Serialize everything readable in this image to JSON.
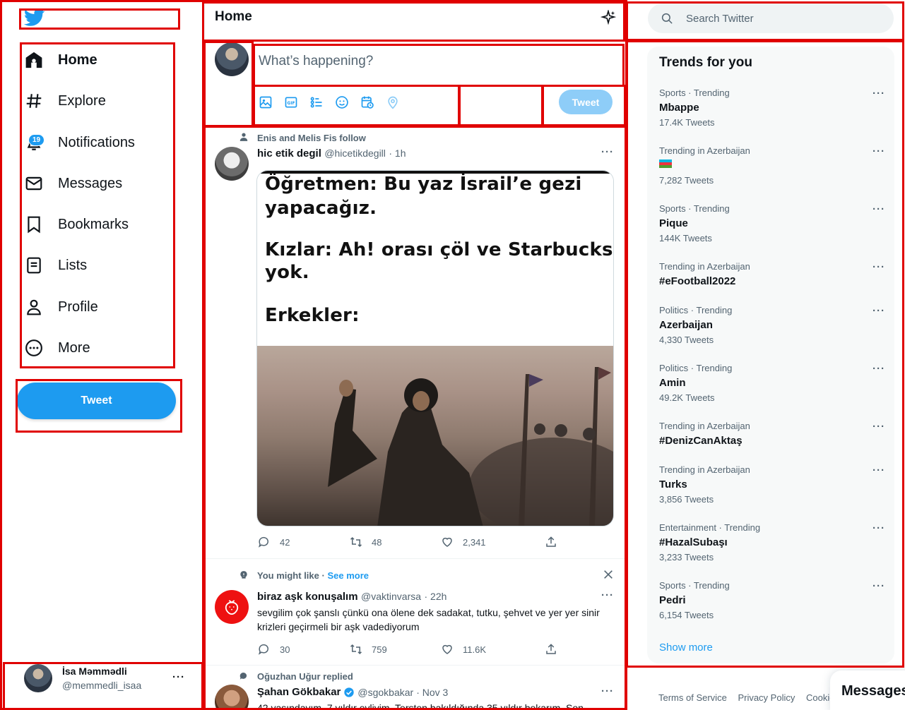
{
  "sidebar": {
    "items": [
      {
        "label": "Home",
        "icon": "home-icon"
      },
      {
        "label": "Explore",
        "icon": "hashtag-icon"
      },
      {
        "label": "Notifications",
        "icon": "bell-icon",
        "badge": "19"
      },
      {
        "label": "Messages",
        "icon": "envelope-icon"
      },
      {
        "label": "Bookmarks",
        "icon": "bookmark-icon"
      },
      {
        "label": "Lists",
        "icon": "list-icon"
      },
      {
        "label": "Profile",
        "icon": "person-icon"
      },
      {
        "label": "More",
        "icon": "more-circle-icon"
      }
    ],
    "tweet_button": "Tweet",
    "account": {
      "name": "İsa Məmmədli",
      "handle": "@memmedli_isaa",
      "menu": "···"
    }
  },
  "header": {
    "title": "Home"
  },
  "compose": {
    "placeholder": "What’s happening?",
    "tweet_button": "Tweet"
  },
  "feed": [
    {
      "context": "Enis and Melis Fis follow",
      "name": "hic etik degil",
      "handle": "@hicetikdegill",
      "time": "· 1h",
      "image_lines": [
        "Öğretmen: Bu yaz İsrail’e gezi",
        "yapacağız.",
        "Kızlar: Ah! orası çöl ve Starbucks",
        "yok.",
        "Erkekler:"
      ],
      "replies": "42",
      "retweets": "48",
      "likes": "2,341"
    },
    {
      "context": "You might like",
      "context_link": "See more",
      "name": "biraz aşk konuşalım",
      "handle": "@vaktinvarsa",
      "time": "· 22h",
      "text": "sevgilim çok şanslı çünkü ona ölene dek sadakat, tutku, şehvet ve yer yer sinir krizleri geçirmeli bir aşk vadediyorum",
      "replies": "30",
      "retweets": "759",
      "likes": "11.6K"
    },
    {
      "context": "Oğuzhan Uğur replied",
      "name": "Şahan Gökbakar",
      "handle": "@sgokbakar",
      "time": "· Nov 3",
      "text": "42 yaşındayım, 7 yıldır evliyim. Tersten bakıldığında 35 yıldır bekarım. Son"
    }
  ],
  "search": {
    "placeholder": "Search Twitter"
  },
  "trends": {
    "title": "Trends for you",
    "items": [
      {
        "context": "Sports · Trending",
        "name": "Mbappe",
        "count": "17.4K Tweets"
      },
      {
        "context": "Trending in Azerbaijan",
        "name": "",
        "flag": true,
        "count": "7,282 Tweets"
      },
      {
        "context": "Sports · Trending",
        "name": "Pique",
        "count": "144K Tweets"
      },
      {
        "context": "Trending in Azerbaijan",
        "name": "#eFootball2022",
        "count": ""
      },
      {
        "context": "Politics · Trending",
        "name": "Azerbaijan",
        "count": "4,330 Tweets"
      },
      {
        "context": "Politics · Trending",
        "name": "Amin",
        "count": "49.2K Tweets"
      },
      {
        "context": "Trending in Azerbaijan",
        "name": "#DenizCanAktaş",
        "count": ""
      },
      {
        "context": "Trending in Azerbaijan",
        "name": "Turks",
        "count": "3,856 Tweets"
      },
      {
        "context": "Entertainment · Trending",
        "name": "#HazalSubaşı",
        "count": "3,233 Tweets"
      },
      {
        "context": "Sports · Trending",
        "name": "Pedri",
        "count": "6,154 Tweets"
      }
    ],
    "show_more": "Show more"
  },
  "footer": {
    "links": [
      "Terms of Service",
      "Privacy Policy",
      "Cookie"
    ]
  },
  "messages_drawer": {
    "label": "Messages"
  },
  "colors": {
    "accent": "#1d9bf0",
    "annotation_boxes": "#e00000"
  }
}
